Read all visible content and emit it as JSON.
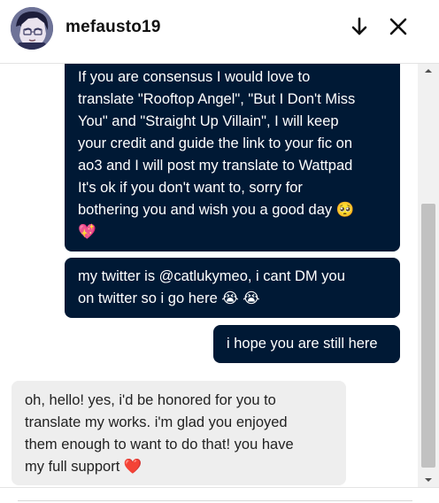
{
  "header": {
    "username": "mefausto19",
    "actions": [
      {
        "name": "arrow-down-icon",
        "label": "collapse"
      },
      {
        "name": "close-icon",
        "label": "close"
      }
    ]
  },
  "messages": [
    {
      "direction": "outgoing",
      "lines": [
        "If you are consensus I would love to",
        "translate \"Rooftop Angel\", \"But I Don't Miss",
        "You\" and \"Straight Up Villain\", I will keep",
        "your credit and guide the link to your fic on",
        "ao3 and I will post my translate to Wattpad",
        "It's ok if you don't want to, sorry for",
        "bothering you and wish you a good day 🥺",
        "💖"
      ]
    },
    {
      "direction": "outgoing",
      "lines": [
        "my twitter is @catlukymeo, i cant DM you",
        "on twitter so i go here 😭 😭"
      ]
    },
    {
      "direction": "outgoing",
      "lines": [
        "i hope you are still here"
      ]
    },
    {
      "direction": "incoming",
      "lines": [
        "oh, hello! yes, i'd be honored for you to",
        "translate my works. i'm glad you enjoyed",
        "them enough to want to do that! you have",
        "my full support ❤️"
      ]
    }
  ],
  "colors": {
    "outgoing_bubble": "#001935",
    "incoming_bubble": "#eeeeee",
    "header_bg": "#ffffff"
  }
}
